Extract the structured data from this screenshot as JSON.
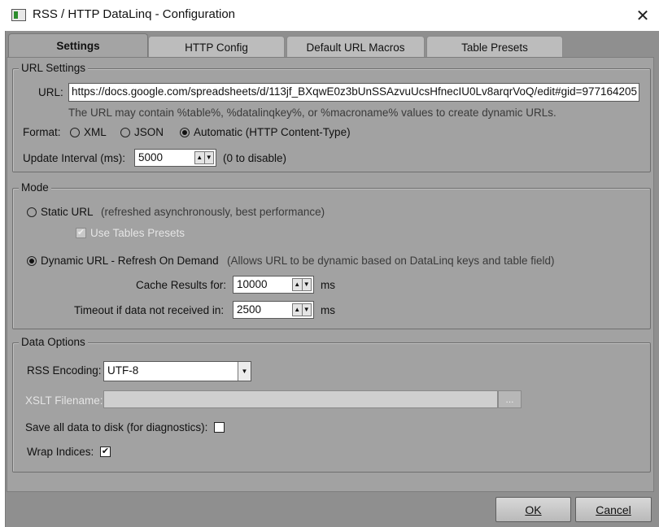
{
  "window": {
    "title": "RSS / HTTP DataLinq - Configuration",
    "close_glyph": "✕",
    "icon": "app-window-icon"
  },
  "tabs": [
    {
      "label": "Settings",
      "active": true
    },
    {
      "label": "HTTP Config",
      "active": false
    },
    {
      "label": "Default URL Macros",
      "active": false
    },
    {
      "label": "Table Presets",
      "active": false
    }
  ],
  "url_settings": {
    "legend": "URL Settings",
    "url_label": "URL:",
    "url_value": "https://docs.google.com/spreadsheets/d/113jf_BXqwE0z3bUnSSAzvuUcsHfnecIU0Lv8arqrVoQ/edit#gid=977164205",
    "url_hint": "The URL may contain %table%, %datalinqkey%, or %macroname% values to create dynamic URLs.",
    "format_label": "Format:",
    "format_options": [
      {
        "label": "XML",
        "selected": false
      },
      {
        "label": "JSON",
        "selected": false
      },
      {
        "label": "Automatic (HTTP Content-Type)",
        "selected": true
      }
    ],
    "update_interval_label": "Update Interval (ms):",
    "update_interval_value": "5000",
    "update_interval_hint": "(0 to disable)"
  },
  "mode": {
    "legend": "Mode",
    "static_url_label": "Static URL",
    "static_url_selected": false,
    "static_url_hint": "(refreshed asynchronously, best performance)",
    "use_tables_presets_label": "Use Tables Presets",
    "use_tables_presets_checked": true,
    "dynamic_url_label": "Dynamic URL - Refresh On Demand",
    "dynamic_url_selected": true,
    "dynamic_url_hint": "(Allows URL to be dynamic based on DataLinq keys and table field)",
    "cache_label": "Cache Results for:",
    "cache_value": "10000",
    "cache_unit": "ms",
    "timeout_label": "Timeout if data not received in:",
    "timeout_value": "2500",
    "timeout_unit": "ms"
  },
  "data_options": {
    "legend": "Data Options",
    "rss_encoding_label": "RSS Encoding:",
    "rss_encoding_value": "UTF-8",
    "xslt_label": "XSLT Filename:",
    "xslt_value": "",
    "xslt_browse": "...",
    "save_disk_label": "Save all data to disk (for diagnostics):",
    "save_disk_checked": false,
    "wrap_indices_label": "Wrap Indices:",
    "wrap_indices_checked": true
  },
  "buttons": {
    "ok": "OK",
    "cancel": "Cancel"
  },
  "glyphs": {
    "check": "✔",
    "spin_up": "▲",
    "spin_down": "▼",
    "dropdown": "▼"
  }
}
